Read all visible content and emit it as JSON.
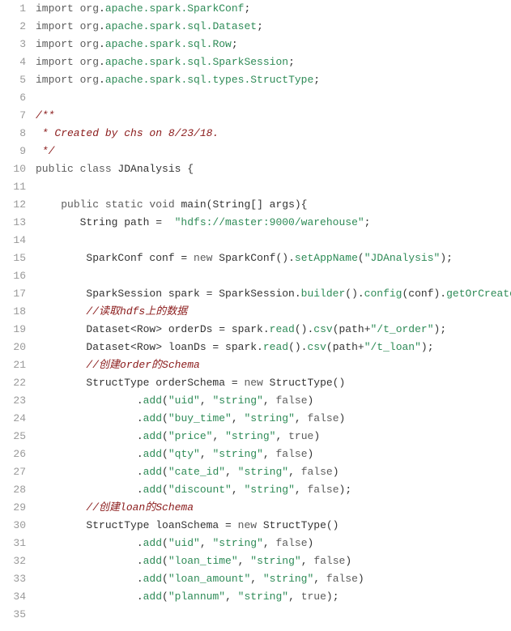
{
  "lines": [
    {
      "n": 1,
      "tokens": [
        [
          "kw",
          "import "
        ],
        [
          "pkg-pre",
          "org"
        ],
        [
          "punct",
          "."
        ],
        [
          "pkg",
          "apache.spark.SparkConf"
        ],
        [
          "punct",
          ";"
        ]
      ]
    },
    {
      "n": 2,
      "tokens": [
        [
          "kw",
          "import "
        ],
        [
          "pkg-pre",
          "org"
        ],
        [
          "punct",
          "."
        ],
        [
          "pkg",
          "apache.spark.sql.Dataset"
        ],
        [
          "punct",
          ";"
        ]
      ]
    },
    {
      "n": 3,
      "tokens": [
        [
          "kw",
          "import "
        ],
        [
          "pkg-pre",
          "org"
        ],
        [
          "punct",
          "."
        ],
        [
          "pkg",
          "apache.spark.sql.Row"
        ],
        [
          "punct",
          ";"
        ]
      ]
    },
    {
      "n": 4,
      "tokens": [
        [
          "kw",
          "import "
        ],
        [
          "pkg-pre",
          "org"
        ],
        [
          "punct",
          "."
        ],
        [
          "pkg",
          "apache.spark.sql.SparkSession"
        ],
        [
          "punct",
          ";"
        ]
      ]
    },
    {
      "n": 5,
      "tokens": [
        [
          "kw",
          "import "
        ],
        [
          "pkg-pre",
          "org"
        ],
        [
          "punct",
          "."
        ],
        [
          "pkg",
          "apache.spark.sql.types.StructType"
        ],
        [
          "punct",
          ";"
        ]
      ]
    },
    {
      "n": 6,
      "tokens": []
    },
    {
      "n": 7,
      "tokens": [
        [
          "comment",
          "/**"
        ]
      ]
    },
    {
      "n": 8,
      "tokens": [
        [
          "comment",
          " * Created by chs on 8/23/18."
        ]
      ]
    },
    {
      "n": 9,
      "tokens": [
        [
          "comment",
          " */"
        ]
      ]
    },
    {
      "n": 10,
      "tokens": [
        [
          "kw",
          "public class "
        ],
        [
          "ident",
          "JDAnalysis {"
        ]
      ]
    },
    {
      "n": 11,
      "tokens": []
    },
    {
      "n": 12,
      "tokens": [
        [
          "ident",
          "    "
        ],
        [
          "kw",
          "public static void "
        ],
        [
          "ident",
          "main(String[] args){"
        ]
      ]
    },
    {
      "n": 13,
      "tokens": [
        [
          "ident",
          "       String path = "
        ],
        [
          "str",
          " \"hdfs://master:9000/warehouse\""
        ],
        [
          "punct",
          ";"
        ]
      ]
    },
    {
      "n": 14,
      "tokens": []
    },
    {
      "n": 15,
      "tokens": [
        [
          "ident",
          "        SparkConf conf = "
        ],
        [
          "kw",
          "new "
        ],
        [
          "ident",
          "SparkConf()."
        ],
        [
          "method",
          "setAppName"
        ],
        [
          "punct",
          "("
        ],
        [
          "str",
          "\"JDAnalysis\""
        ],
        [
          "punct",
          ");"
        ]
      ]
    },
    {
      "n": 16,
      "tokens": []
    },
    {
      "n": 17,
      "tokens": [
        [
          "ident",
          "        SparkSession spark = SparkSession."
        ],
        [
          "method",
          "builder"
        ],
        [
          "ident",
          "()."
        ],
        [
          "method",
          "config"
        ],
        [
          "ident",
          "(conf)."
        ],
        [
          "method",
          "getOrCreate"
        ],
        [
          "punct",
          "();"
        ]
      ]
    },
    {
      "n": 18,
      "tokens": [
        [
          "ident",
          "        "
        ],
        [
          "comment",
          "//读取hdfs上的数据"
        ]
      ]
    },
    {
      "n": 19,
      "tokens": [
        [
          "ident",
          "        Dataset<Row> orderDs = spark."
        ],
        [
          "method",
          "read"
        ],
        [
          "ident",
          "()."
        ],
        [
          "method",
          "csv"
        ],
        [
          "ident",
          "(path+"
        ],
        [
          "str",
          "\"/t_order\""
        ],
        [
          "punct",
          ");"
        ]
      ]
    },
    {
      "n": 20,
      "tokens": [
        [
          "ident",
          "        Dataset<Row> loanDs = spark."
        ],
        [
          "method",
          "read"
        ],
        [
          "ident",
          "()."
        ],
        [
          "method",
          "csv"
        ],
        [
          "ident",
          "(path+"
        ],
        [
          "str",
          "\"/t_loan\""
        ],
        [
          "punct",
          ");"
        ]
      ]
    },
    {
      "n": 21,
      "tokens": [
        [
          "ident",
          "        "
        ],
        [
          "comment",
          "//创建order的Schema"
        ]
      ]
    },
    {
      "n": 22,
      "tokens": [
        [
          "ident",
          "        StructType orderSchema = "
        ],
        [
          "kw",
          "new "
        ],
        [
          "ident",
          "StructType()"
        ]
      ]
    },
    {
      "n": 23,
      "tokens": [
        [
          "ident",
          "                ."
        ],
        [
          "method",
          "add"
        ],
        [
          "punct",
          "("
        ],
        [
          "str",
          "\"uid\""
        ],
        [
          "punct",
          ", "
        ],
        [
          "str",
          "\"string\""
        ],
        [
          "punct",
          ", "
        ],
        [
          "bool",
          "false"
        ],
        [
          "punct",
          ")"
        ]
      ]
    },
    {
      "n": 24,
      "tokens": [
        [
          "ident",
          "                ."
        ],
        [
          "method",
          "add"
        ],
        [
          "punct",
          "("
        ],
        [
          "str",
          "\"buy_time\""
        ],
        [
          "punct",
          ", "
        ],
        [
          "str",
          "\"string\""
        ],
        [
          "punct",
          ", "
        ],
        [
          "bool",
          "false"
        ],
        [
          "punct",
          ")"
        ]
      ]
    },
    {
      "n": 25,
      "tokens": [
        [
          "ident",
          "                ."
        ],
        [
          "method",
          "add"
        ],
        [
          "punct",
          "("
        ],
        [
          "str",
          "\"price\""
        ],
        [
          "punct",
          ", "
        ],
        [
          "str",
          "\"string\""
        ],
        [
          "punct",
          ", "
        ],
        [
          "bool",
          "true"
        ],
        [
          "punct",
          ")"
        ]
      ]
    },
    {
      "n": 26,
      "tokens": [
        [
          "ident",
          "                ."
        ],
        [
          "method",
          "add"
        ],
        [
          "punct",
          "("
        ],
        [
          "str",
          "\"qty\""
        ],
        [
          "punct",
          ", "
        ],
        [
          "str",
          "\"string\""
        ],
        [
          "punct",
          ", "
        ],
        [
          "bool",
          "false"
        ],
        [
          "punct",
          ")"
        ]
      ]
    },
    {
      "n": 27,
      "tokens": [
        [
          "ident",
          "                ."
        ],
        [
          "method",
          "add"
        ],
        [
          "punct",
          "("
        ],
        [
          "str",
          "\"cate_id\""
        ],
        [
          "punct",
          ", "
        ],
        [
          "str",
          "\"string\""
        ],
        [
          "punct",
          ", "
        ],
        [
          "bool",
          "false"
        ],
        [
          "punct",
          ")"
        ]
      ]
    },
    {
      "n": 28,
      "tokens": [
        [
          "ident",
          "                ."
        ],
        [
          "method",
          "add"
        ],
        [
          "punct",
          "("
        ],
        [
          "str",
          "\"discount\""
        ],
        [
          "punct",
          ", "
        ],
        [
          "str",
          "\"string\""
        ],
        [
          "punct",
          ", "
        ],
        [
          "bool",
          "false"
        ],
        [
          "punct",
          ");"
        ]
      ]
    },
    {
      "n": 29,
      "tokens": [
        [
          "ident",
          "        "
        ],
        [
          "comment",
          "//创建loan的Schema"
        ]
      ]
    },
    {
      "n": 30,
      "tokens": [
        [
          "ident",
          "        StructType loanSchema = "
        ],
        [
          "kw",
          "new "
        ],
        [
          "ident",
          "StructType()"
        ]
      ]
    },
    {
      "n": 31,
      "tokens": [
        [
          "ident",
          "                ."
        ],
        [
          "method",
          "add"
        ],
        [
          "punct",
          "("
        ],
        [
          "str",
          "\"uid\""
        ],
        [
          "punct",
          ", "
        ],
        [
          "str",
          "\"string\""
        ],
        [
          "punct",
          ", "
        ],
        [
          "bool",
          "false"
        ],
        [
          "punct",
          ")"
        ]
      ]
    },
    {
      "n": 32,
      "tokens": [
        [
          "ident",
          "                ."
        ],
        [
          "method",
          "add"
        ],
        [
          "punct",
          "("
        ],
        [
          "str",
          "\"loan_time\""
        ],
        [
          "punct",
          ", "
        ],
        [
          "str",
          "\"string\""
        ],
        [
          "punct",
          ", "
        ],
        [
          "bool",
          "false"
        ],
        [
          "punct",
          ")"
        ]
      ]
    },
    {
      "n": 33,
      "tokens": [
        [
          "ident",
          "                ."
        ],
        [
          "method",
          "add"
        ],
        [
          "punct",
          "("
        ],
        [
          "str",
          "\"loan_amount\""
        ],
        [
          "punct",
          ", "
        ],
        [
          "str",
          "\"string\""
        ],
        [
          "punct",
          ", "
        ],
        [
          "bool",
          "false"
        ],
        [
          "punct",
          ")"
        ]
      ]
    },
    {
      "n": 34,
      "tokens": [
        [
          "ident",
          "                ."
        ],
        [
          "method",
          "add"
        ],
        [
          "punct",
          "("
        ],
        [
          "str",
          "\"plannum\""
        ],
        [
          "punct",
          ", "
        ],
        [
          "str",
          "\"string\""
        ],
        [
          "punct",
          ", "
        ],
        [
          "bool",
          "true"
        ],
        [
          "punct",
          ");"
        ]
      ]
    },
    {
      "n": 35,
      "tokens": []
    }
  ]
}
